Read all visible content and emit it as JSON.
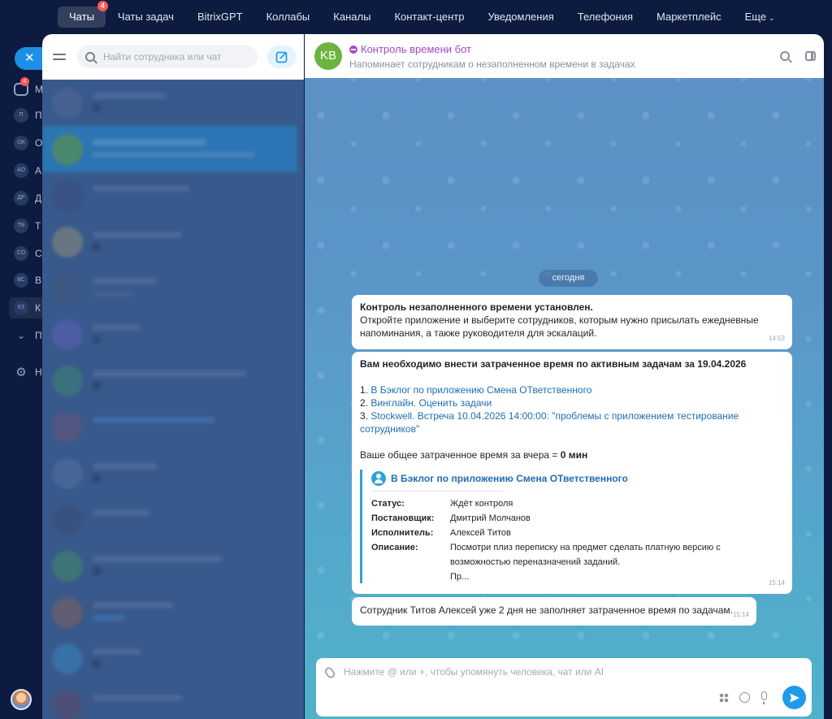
{
  "topnav": {
    "items": [
      {
        "label": "Чаты",
        "badge": "4",
        "active": true
      },
      {
        "label": "Чаты задач"
      },
      {
        "label": "BitrixGPT"
      },
      {
        "label": "Коллабы"
      },
      {
        "label": "Каналы"
      },
      {
        "label": "Контакт-центр"
      },
      {
        "label": "Уведомления"
      },
      {
        "label": "Телефония"
      },
      {
        "label": "Маркетплейс"
      },
      {
        "label": "Еще"
      }
    ]
  },
  "rail": {
    "close_icon": "close-icon",
    "chat_badge": "4",
    "items": [
      {
        "initials": "",
        "letter": "М"
      },
      {
        "initials": "П",
        "letter": "П"
      },
      {
        "initials": "ОК",
        "letter": "О"
      },
      {
        "initials": "АО",
        "letter": "А"
      },
      {
        "initials": "ДР",
        "letter": "Д"
      },
      {
        "initials": "ТБ",
        "letter": "Т"
      },
      {
        "initials": "СО",
        "letter": "С"
      },
      {
        "initials": "ВС",
        "letter": "В"
      },
      {
        "initials": "КЗ",
        "letter": "К"
      },
      {
        "initials": "",
        "letter": "П"
      },
      {
        "initials": "",
        "letter": "Н"
      }
    ]
  },
  "list": {
    "search_placeholder": "Найти сотрудника или чат"
  },
  "chat": {
    "avatar_initials": "KB",
    "avatar_color": "#6db33f",
    "title": "Контроль времени бот",
    "subtitle": "Напоминает сотрудникам о незаполненном времени в задачах",
    "date_divider": "сегодня",
    "messages": {
      "m1": {
        "title": "Контроль незаполненного времени установлен.",
        "text": "Откройте приложение и выберите сотрудников, которым нужно присылать ежедневные напоминания, а также руководителя для эскалаций.",
        "time": "14:53"
      },
      "m2": {
        "title": "Вам необходимо внести затраченное время по активным задачам за 19.04.2026",
        "tasks": [
          {
            "num": "1.",
            "label": "В Бэклог по приложению Смена ОТветственного"
          },
          {
            "num": "2.",
            "label": "Винглайн. Оценить задачи"
          },
          {
            "num": "3.",
            "label": "Stockwell. Встреча 10.04.2026 14:00:00: \"проблемы с приложением тестирование сотрудников\""
          }
        ],
        "total_prefix": "Ваше общее затраченное время за вчера = ",
        "total_value": "0 мин",
        "card": {
          "title": "В Бэклог по приложению Смена ОТветственного",
          "fields": [
            {
              "label": "Статус:",
              "value": "Ждёт контроля"
            },
            {
              "label": "Постановщик:",
              "value": "Дмитрий Молчанов"
            },
            {
              "label": "Исполнитель:",
              "value": "Алексей Титов"
            },
            {
              "label": "Описание:",
              "value": "Посмотри плиз переписку на предмет сделать платную версию с возможностью переназначений заданий.\nПр..."
            }
          ]
        },
        "time": "15:14"
      },
      "m3": {
        "text": "Сотрудник Титов Алексей уже 2 дня не заполняет затраченное время по задачам.",
        "time": "15:14"
      }
    },
    "composer_placeholder": "Нажмите @ или +, чтобы упомянуть человека, чат или AI"
  }
}
